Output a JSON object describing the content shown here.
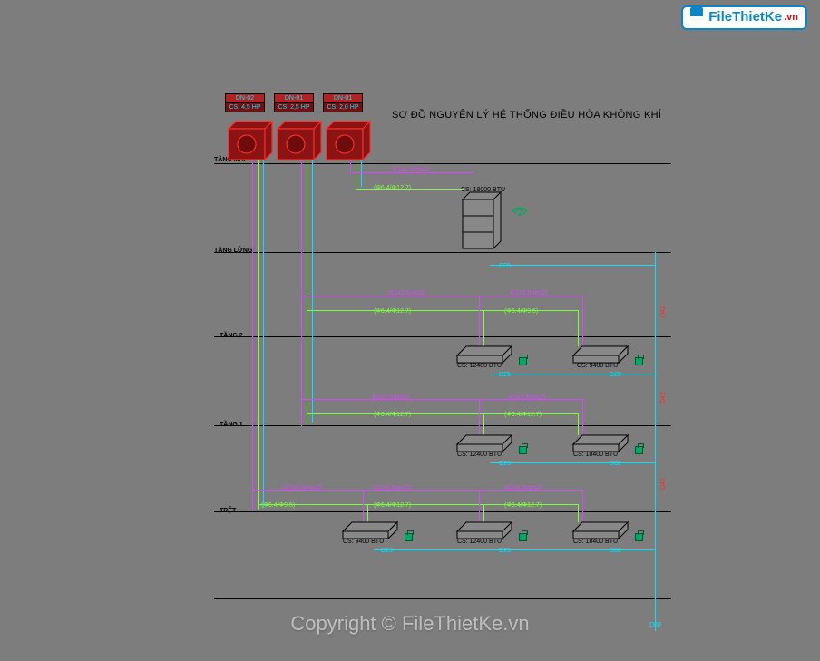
{
  "logo": {
    "brand": "FileThietKe",
    "tld": ".vn"
  },
  "copyright": "Copyright © FileThietKe.vn",
  "title": "SƠ ĐỒ NGUYÊN LÝ HỆ THỐNG ĐIỀU HÒA KHÔNG KHÍ",
  "floors": {
    "roof": "TẦNG MÁI",
    "lung": "TẦNG LỬNG",
    "t2": "TẦNG 2",
    "t1": "TẦNG 1",
    "tret": "TRỆT"
  },
  "outdoor": [
    {
      "tag": "DN-02",
      "hp": "CS: 4,5 HP"
    },
    {
      "tag": "DN-01",
      "hp": "CS: 2,5 HP"
    },
    {
      "tag": "DN-01",
      "hp": "CS: 2,0 HP"
    }
  ],
  "cabinet": {
    "cap": "CS: 18000 BTU"
  },
  "floor2_units": [
    {
      "cap": "CS: 12400 BTU",
      "d": "D25"
    },
    {
      "cap": "CS: 9400 BTU",
      "d": "D25"
    }
  ],
  "floor1_units": [
    {
      "cap": "CS: 12400 BTU",
      "d": "D25"
    },
    {
      "cap": "CS: 18400 BTU",
      "d": "D32"
    }
  ],
  "tret_units": [
    {
      "cap": "CS: 9400 BTU",
      "d": "D25"
    },
    {
      "cap": "CS: 12400 BTU",
      "d": "D25"
    },
    {
      "cap": "CS: 18400 BTU",
      "d": "D32"
    }
  ],
  "wire_notes": {
    "l1": "4(1x2.5mm2)",
    "l1b": "(Φ6.4/Φ12.7)",
    "l2": "3(1x2.5mm2)",
    "l3": "4(1x2.5mm2)",
    "l3b": "(Φ6.4/Φ9.5)",
    "l4": "4(1x2.5mm2)",
    "l5": "4(1x2.5mm2)",
    "l6": "13(1x2.5mm2)"
  },
  "riser": {
    "r1": "D42",
    "r2": "D42",
    "r3": "D42",
    "bottom": "D60"
  }
}
